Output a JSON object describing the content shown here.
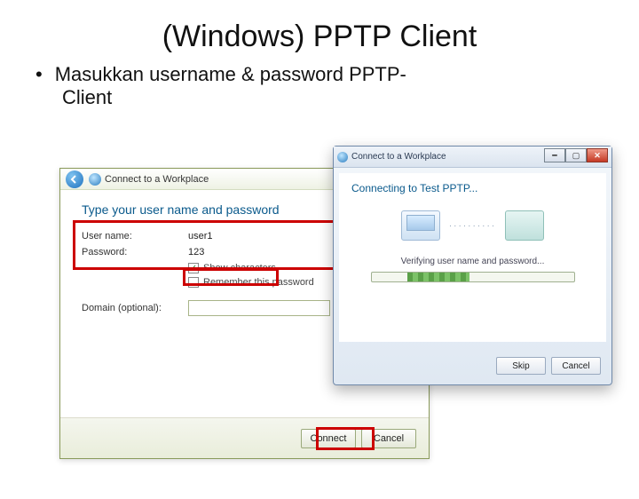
{
  "slide": {
    "title": "(Windows) PPTP Client",
    "bullet_line1": "Masukkan username & password PPTP-",
    "bullet_line2": "Client"
  },
  "left_window": {
    "title": "Connect to a Workplace",
    "heading": "Type your user name and password",
    "username_label": "User name:",
    "username_value": "user1",
    "password_label": "Password:",
    "password_value": "123",
    "show_characters_label": "Show characters",
    "remember_label": "Remember this password",
    "domain_label": "Domain (optional):",
    "connect_button": "Connect",
    "cancel_button": "Cancel"
  },
  "right_dialog": {
    "title": "Connect to a Workplace",
    "heading": "Connecting to Test PPTP...",
    "status": "Verifying user name and password...",
    "skip_button": "Skip",
    "cancel_button": "Cancel"
  }
}
